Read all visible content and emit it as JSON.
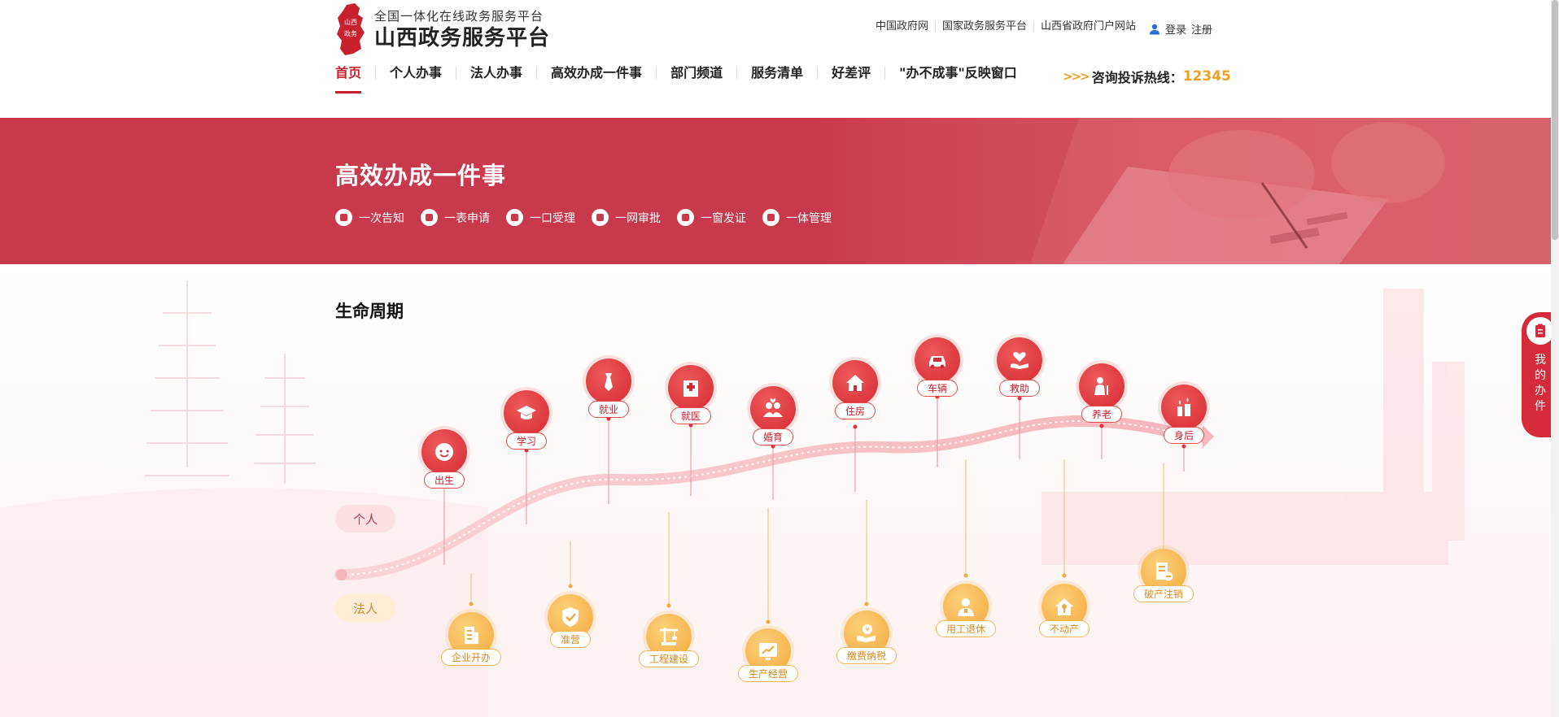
{
  "header": {
    "logo_subtitle": "全国一体化在线政务服务平台",
    "logo_title": "山西政务服务平台",
    "logo_badge_text": "山西政务",
    "top_links": [
      "中国政府网",
      "国家政务服务平台",
      "山西省政府门户网站"
    ],
    "login": "登录",
    "register": "注册",
    "nav": [
      "首页",
      "个人办事",
      "法人办事",
      "高效办成一件事",
      "部门频道",
      "服务清单",
      "好差评",
      "\"办不成事\"反映窗口"
    ],
    "hotline_label": "咨询投诉热线：",
    "hotline_number": "12345",
    "hotline_arrows": ">>>"
  },
  "banner": {
    "title": "高效办成一件事",
    "features": [
      "一次告知",
      "一表申请",
      "一口受理",
      "一网审批",
      "一窗发证",
      "一体管理"
    ]
  },
  "lifecycle": {
    "title": "生命周期",
    "person_tag": "个人",
    "corp_tag": "法人",
    "person_nodes": [
      {
        "label": "出生",
        "icon": "baby-icon"
      },
      {
        "label": "学习",
        "icon": "graduation-cap-icon"
      },
      {
        "label": "就业",
        "icon": "tie-icon"
      },
      {
        "label": "就医",
        "icon": "hospital-icon"
      },
      {
        "label": "婚育",
        "icon": "couple-icon"
      },
      {
        "label": "住房",
        "icon": "house-icon"
      },
      {
        "label": "车辆",
        "icon": "car-icon"
      },
      {
        "label": "救助",
        "icon": "heart-hand-icon"
      },
      {
        "label": "养老",
        "icon": "elder-icon"
      },
      {
        "label": "身后",
        "icon": "candle-icon"
      }
    ],
    "corp_nodes": [
      {
        "label": "企业开办",
        "icon": "building-icon"
      },
      {
        "label": "准营",
        "icon": "shield-check-icon"
      },
      {
        "label": "工程建设",
        "icon": "crane-icon"
      },
      {
        "label": "生产经营",
        "icon": "trend-chart-icon"
      },
      {
        "label": "缴费纳税",
        "icon": "coin-hand-icon"
      },
      {
        "label": "用工退休",
        "icon": "worker-icon"
      },
      {
        "label": "不动产",
        "icon": "property-key-icon"
      },
      {
        "label": "破产注销",
        "icon": "document-cancel-icon"
      }
    ]
  },
  "side_float": {
    "label": "我的办件"
  },
  "colors": {
    "brand_red": "#c8202f",
    "banner_red": "#c8394b",
    "accent_orange": "#f0a020"
  }
}
